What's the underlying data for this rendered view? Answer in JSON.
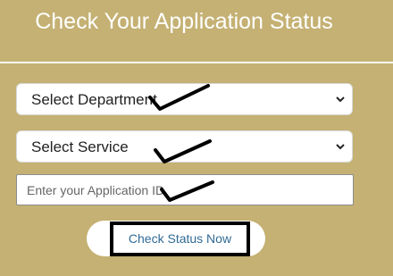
{
  "form": {
    "title": "Check Your Application Status",
    "department_select": {
      "selected": "Select Department"
    },
    "service_select": {
      "selected": "Select Service"
    },
    "application_id": {
      "value": "",
      "placeholder": "Enter your Application ID"
    },
    "submit_label": "Check Status Now"
  },
  "icons": {
    "select_arrow": "chevron-down-icon",
    "annotation_mark": "checkmark-icon"
  },
  "colors": {
    "background": "#c4b173",
    "title_text": "#ffffff",
    "button_text": "#2f6a94",
    "button_border": "#000000",
    "annotation": "#000000"
  }
}
